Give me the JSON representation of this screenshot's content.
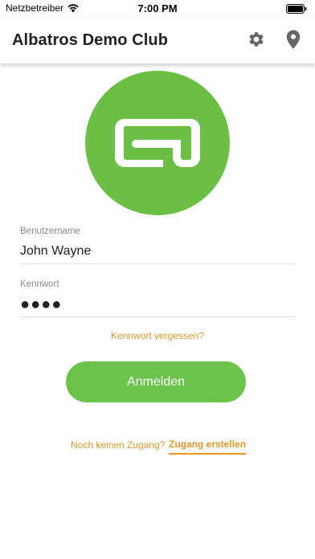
{
  "status_bar": {
    "carrier": "Netzbetreiber",
    "time": "7:00 PM",
    "icons": [
      "wifi-icon",
      "battery-icon"
    ]
  },
  "app_bar": {
    "title": "Albatros Demo Club",
    "actions": [
      "gear-icon",
      "location-pin-icon"
    ]
  },
  "logo": {
    "color": "#6cbf45"
  },
  "form": {
    "username": {
      "label": "Benutzername",
      "value": "John Wayne"
    },
    "password": {
      "label": "Kennwort",
      "value": "●●●●"
    },
    "forgot_password": "Kennwort vergessen?",
    "login_button": "Anmelden"
  },
  "signup": {
    "prompt": "Noch keinen Zugang?",
    "link": "Zugang erstellen"
  },
  "colors": {
    "brand_green": "#6cc34c",
    "accent_orange": "#e8962b"
  }
}
